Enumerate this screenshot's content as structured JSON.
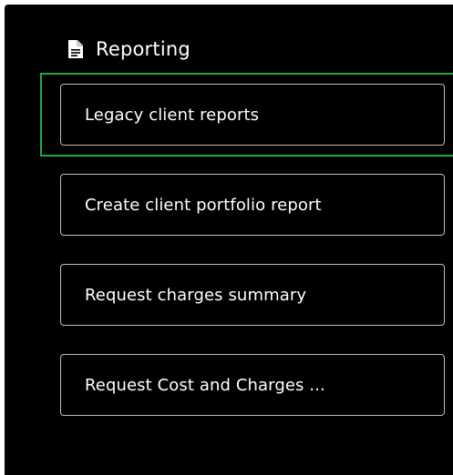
{
  "reporting": {
    "title": "Reporting",
    "icon": "document-icon",
    "items": [
      {
        "label": "Legacy client reports",
        "focused": true
      },
      {
        "label": "Create client portfolio report",
        "focused": false
      },
      {
        "label": "Request charges summary",
        "focused": false
      },
      {
        "label": "Request Cost and Charges ...",
        "focused": false
      }
    ]
  },
  "colors": {
    "background": "#000000",
    "text": "#ffffff",
    "item_border": "#bdbdbd",
    "focus": "#1faa3e"
  }
}
